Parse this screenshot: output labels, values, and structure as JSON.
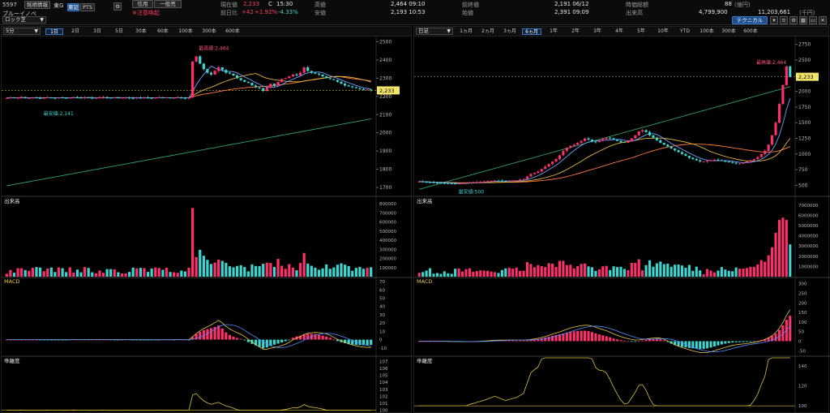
{
  "header": {
    "code": "5597",
    "stock_info_btn": "銘柄情報",
    "market": "東G",
    "name": "ブルーイノベ",
    "exchange_tse": "東証",
    "exchange_pts": "PTS",
    "gear_icon": "gear-icon",
    "credit_btn": "信用",
    "general_btn": "一般売",
    "alert": "※注意喚起",
    "current_label": "現在値",
    "current_value": "2,233",
    "current_flag": "C",
    "current_time": "15:30",
    "change_label": "前日比",
    "change_value": "+42",
    "change_pct": "+1.92%",
    "change_pct2": "-4.33%",
    "high_label": "高値",
    "high_value": "2,464 09:10",
    "low_label": "安値",
    "low_value": "2,193 10:53",
    "prev_label": "前終値",
    "prev_value": "2,191 06/12",
    "open_label": "始値",
    "open_value": "2,391 09:09",
    "mcap_label": "時価総額",
    "mcap_value": "88",
    "mcap_unit": "(億円)",
    "volume_label": "出来高",
    "volume_value": "4,799,900",
    "turnover_value": "11,203,661",
    "turnover_unit": "(千円)",
    "technical_btn": "テクニカル",
    "lock_select": "ロック芝"
  },
  "left_chart": {
    "interval": "5分",
    "tabs": [
      "1日",
      "2日",
      "3日",
      "5日",
      "30本",
      "60本",
      "100本",
      "300本",
      "600本"
    ],
    "active_tab": 0,
    "current_price": "2,233",
    "high_note": "最高値:2,464",
    "low_note": "最安値:2,141",
    "volume_label": "出来高",
    "macd_label": "MACD",
    "psy_label": "乖離度"
  },
  "right_chart": {
    "interval": "日足",
    "tabs": [
      "1ヵ月",
      "2ヵ月",
      "3ヵ月",
      "6ヵ月",
      "1年",
      "2年",
      "3年",
      "4年",
      "5年",
      "10年",
      "YTD",
      "100本",
      "300本",
      "600本"
    ],
    "active_tab": 3,
    "current_price": "2,233",
    "high_note": "最高値:2,464",
    "low_note": "最安値:500",
    "volume_label": "出来高",
    "macd_label": "MACD",
    "psy_label": "乖離度"
  },
  "chart_data": [
    {
      "type": "candlestick",
      "title": "5分足",
      "y_ticks": [
        1700,
        1800,
        1900,
        2000,
        2100,
        2200,
        2300,
        2400,
        2500
      ],
      "ylim": [
        1660,
        2520
      ],
      "current_price": 2233,
      "high": 2464,
      "low": 2141,
      "closes": [
        2191,
        2195,
        2192,
        2193,
        2196,
        2190,
        2192,
        2194,
        2191,
        2189,
        2192,
        2195,
        2193,
        2191,
        2194,
        2192,
        2190,
        2193,
        2196,
        2194,
        2192,
        2195,
        2193,
        2190,
        2192,
        2194,
        2196,
        2193,
        2191,
        2194,
        2192,
        2193,
        2195,
        2192,
        2190,
        2193,
        2191,
        2194,
        2192,
        2191,
        2193,
        2195,
        2192,
        2194,
        2191,
        2193,
        2195,
        2192,
        2190,
        2193,
        2391,
        2420,
        2380,
        2350,
        2330,
        2320,
        2340,
        2360,
        2345,
        2330,
        2325,
        2315,
        2300,
        2290,
        2280,
        2275,
        2260,
        2250,
        2245,
        2230,
        2250,
        2270,
        2260,
        2280,
        2295,
        2300,
        2310,
        2320,
        2315,
        2330,
        2360,
        2340,
        2330,
        2325,
        2320,
        2310,
        2300,
        2295,
        2290,
        2280,
        2270,
        2260,
        2255,
        2250,
        2245,
        2240,
        2235,
        2238,
        2233
      ],
      "ma_short": {
        "color": "#6ea0ff"
      },
      "ma_mid": {
        "color": "#e3b53c"
      },
      "ma_long": {
        "color": "#ff7a3c"
      },
      "ma_trend": {
        "color": "#2f9f6f"
      },
      "volume_ticks": [
        100000,
        200000,
        300000,
        400000,
        500000,
        600000,
        700000,
        800000
      ],
      "volume_max": 820000,
      "macd_ticks": [
        -10,
        0,
        10,
        20,
        30,
        40,
        50,
        60,
        70
      ],
      "macd_lim": [
        -18,
        72
      ],
      "psy_ticks": [
        100,
        101,
        102,
        103,
        104,
        105,
        106,
        107
      ],
      "psy_lim": [
        99.5,
        107.5
      ]
    },
    {
      "type": "candlestick",
      "title": "日足",
      "y_ticks": [
        500,
        750,
        1000,
        1250,
        1500,
        1750,
        2000,
        2250,
        2500,
        2750
      ],
      "ylim": [
        350,
        2850
      ],
      "current_price": 2233,
      "high": 2464,
      "low": 500,
      "closes": [
        560,
        555,
        552,
        548,
        545,
        540,
        538,
        535,
        530,
        528,
        525,
        530,
        535,
        540,
        545,
        548,
        552,
        556,
        560,
        565,
        570,
        575,
        572,
        568,
        565,
        570,
        575,
        580,
        590,
        600,
        640,
        680,
        700,
        720,
        760,
        800,
        840,
        880,
        920,
        980,
        1050,
        1100,
        1130,
        1150,
        1180,
        1210,
        1250,
        1230,
        1200,
        1190,
        1210,
        1240,
        1260,
        1250,
        1230,
        1210,
        1190,
        1180,
        1200,
        1250,
        1300,
        1360,
        1380,
        1350,
        1300,
        1260,
        1220,
        1180,
        1150,
        1120,
        1090,
        1060,
        1030,
        1000,
        970,
        940,
        920,
        900,
        880,
        880,
        890,
        900,
        910,
        900,
        890,
        880,
        870,
        860,
        850,
        850,
        860,
        880,
        900,
        920,
        950,
        1000,
        1050,
        1150,
        1300,
        1500,
        1800,
        2100,
        2400,
        2233
      ],
      "ma_short": {
        "color": "#6ea0ff"
      },
      "ma_mid": {
        "color": "#e3b53c"
      },
      "ma_long": {
        "color": "#ff7a3c"
      },
      "ma_trend": {
        "color": "#2f9f6f"
      },
      "volume_ticks": [
        1000000,
        2000000,
        3000000,
        4000000,
        5000000,
        6000000,
        7000000
      ],
      "volume_max": 7300000,
      "macd_ticks": [
        -50,
        0,
        50,
        100,
        150,
        200,
        250,
        300
      ],
      "macd_lim": [
        -70,
        320
      ],
      "psy_ticks": [
        100,
        120,
        140
      ],
      "psy_lim": [
        92,
        148
      ]
    }
  ]
}
